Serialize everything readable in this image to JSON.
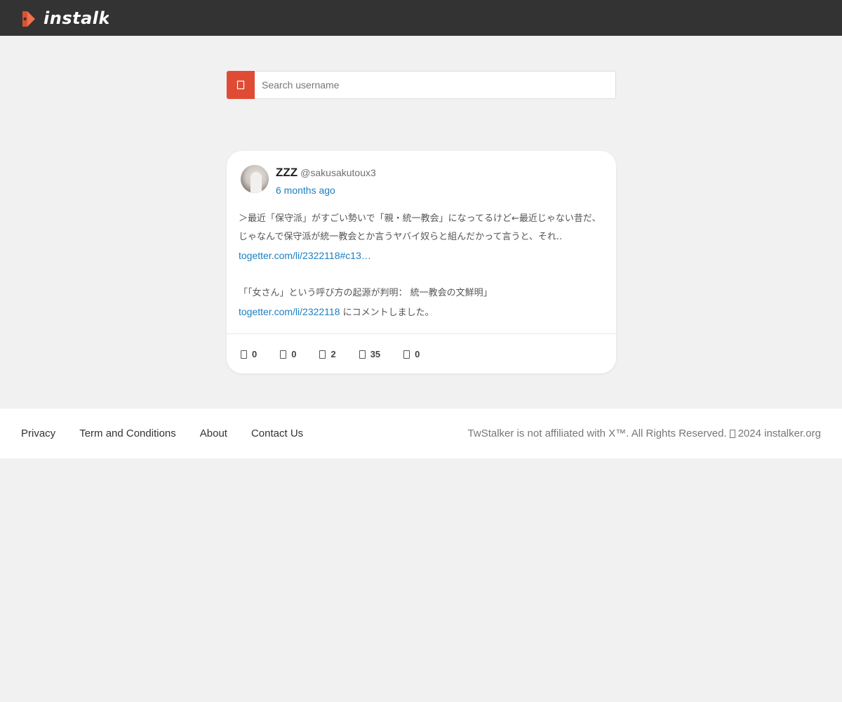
{
  "header": {
    "logo_text": "instalk",
    "colors": {
      "bar": "#333333",
      "logo_mark": "#f0714f"
    }
  },
  "search": {
    "placeholder": "Search username",
    "button_icon": "search-icon",
    "button_color": "#e04b35"
  },
  "post": {
    "display_name": "ZZZ",
    "handle": "@sakusakutoux3",
    "time_ago": "6 months ago",
    "line1_text": "＞最近「保守派」がすごい勢いで「親・統一教会」になってるけど←最近じゃない昔だ、じゃなんで保守派が統一教会とか言うヤバイ奴らと組んだかって言うと、それ..",
    "line1_link": "togetter.com/li/2322118#c13…",
    "line2_text": "「「女さん」という呼び方の起源が判明： 統一教会の文鮮明」",
    "line2_link": "togetter.com/li/2322118",
    "line2_suffix": " にコメントしました。",
    "link_color": "#1b7fc2",
    "stats": [
      {
        "icon": "reply-icon",
        "count": "0"
      },
      {
        "icon": "retweet-icon",
        "count": "0"
      },
      {
        "icon": "like-icon",
        "count": "2"
      },
      {
        "icon": "views-icon",
        "count": "35"
      },
      {
        "icon": "bookmark-icon",
        "count": "0"
      }
    ]
  },
  "footer": {
    "links": [
      "Privacy",
      "Term and Conditions",
      "About",
      "Contact Us"
    ],
    "copyright_prefix": "TwStalker is not affiliated with X™. All Rights Reserved.",
    "copyright_icon": "copyright-icon",
    "copyright_suffix": "2024 instalker.org"
  }
}
